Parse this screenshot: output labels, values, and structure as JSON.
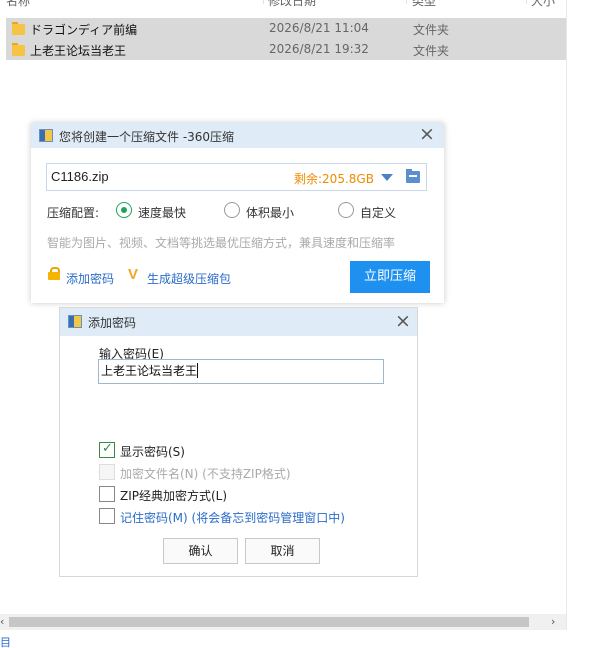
{
  "explorer": {
    "columns": {
      "name": "名称",
      "modified": "修改日期",
      "type": "类型",
      "size": "大小"
    },
    "files": [
      {
        "name": "ドラゴンディア前编",
        "date": "2026/8/21 11:04",
        "type": "文件夹"
      },
      {
        "name": "上老王论坛当老王",
        "date": "2026/8/21 19:32",
        "type": "文件夹"
      }
    ],
    "scroll": {
      "left_icon": "‹",
      "right_icon": "›"
    },
    "status_fragment": "目"
  },
  "compress_dialog": {
    "title": "您将创建一个压缩文件 -360压缩",
    "close_icon": "×",
    "filename": "C1186.zip",
    "free_space": "剩余:205.8GB",
    "config_label": "压缩配置:",
    "options": [
      {
        "label": "速度最快",
        "selected": true
      },
      {
        "label": "体积最小",
        "selected": false
      },
      {
        "label": "自定义",
        "selected": false
      }
    ],
    "hint": "智能为图片、视频、文档等挑选最优压缩方式，兼具速度和压缩率",
    "add_password_link": "添加密码",
    "super_compress_link": "生成超级压缩包",
    "super_compress_icon": "V",
    "compress_button": "立即压缩",
    "colors": {
      "accent": "#1e90f0",
      "free_space": "#f08a00",
      "radio": "#25a05a"
    }
  },
  "password_dialog": {
    "title": "添加密码",
    "close_icon": "×",
    "input_label": "输入密码(E)",
    "password_value": "上老王论坛当老王",
    "checkboxes": [
      {
        "label": "显示密码(S)",
        "checked": true,
        "disabled": false
      },
      {
        "label": "加密文件名(N) (不支持ZIP格式)",
        "checked": false,
        "disabled": true
      },
      {
        "label": "ZIP经典加密方式(L)",
        "checked": false,
        "disabled": false
      },
      {
        "label": "记住密码(M) (将会备忘到密码管理窗口中)",
        "checked": false,
        "disabled": false
      }
    ],
    "ok_button": "确认",
    "cancel_button": "取消"
  }
}
